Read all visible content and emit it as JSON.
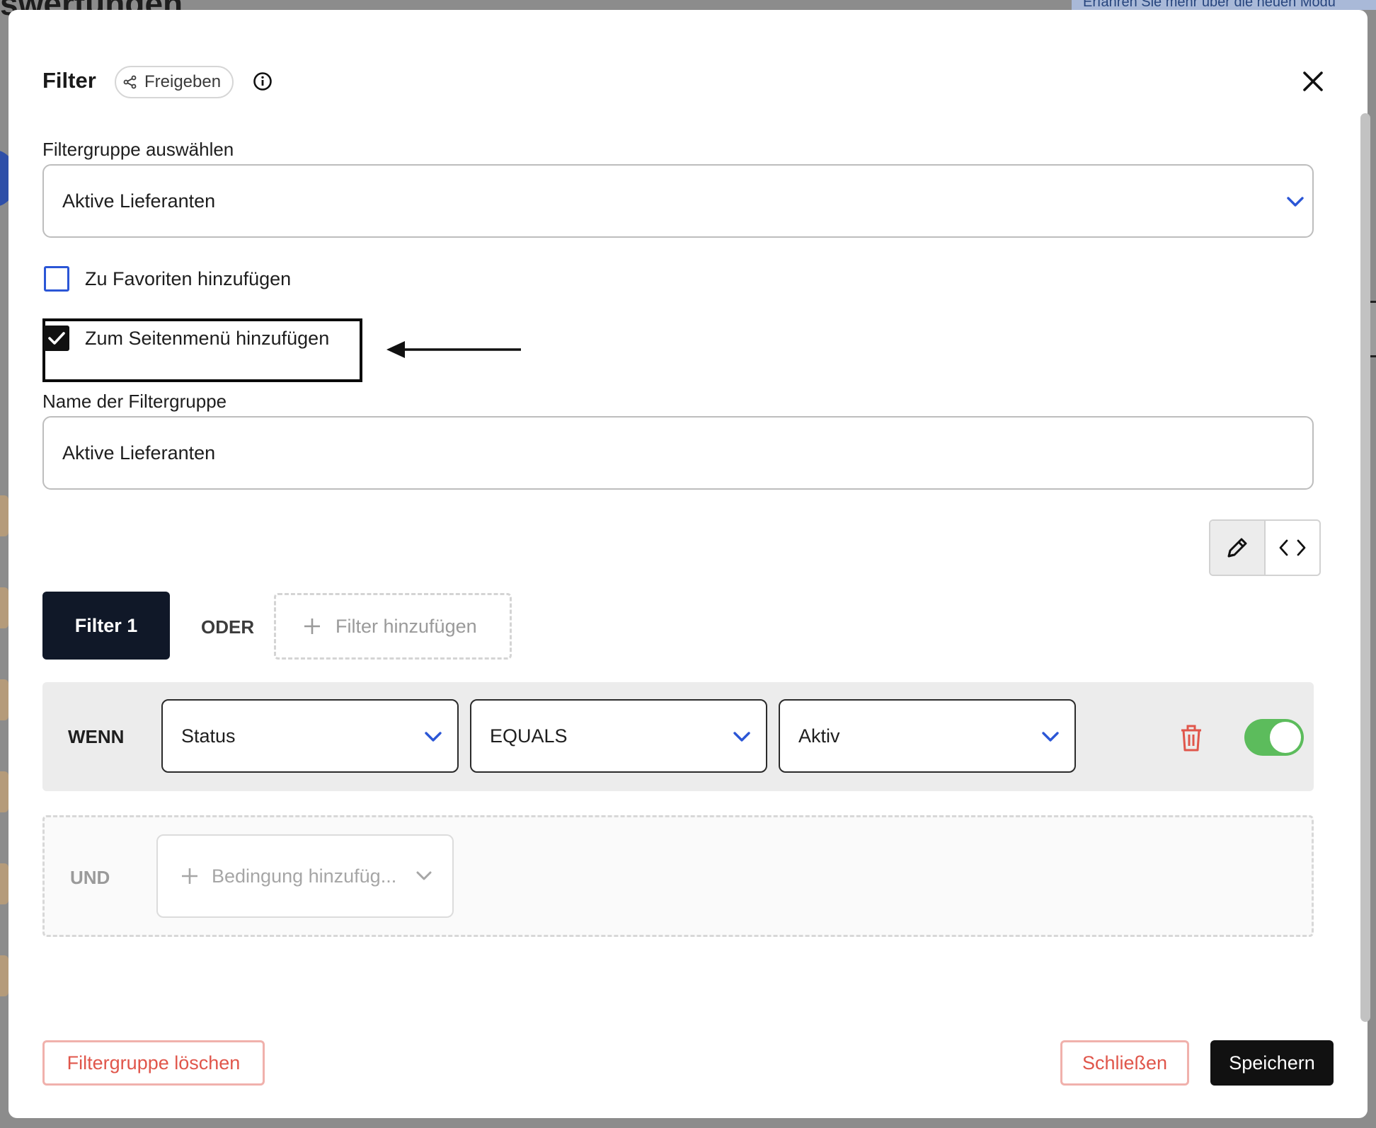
{
  "background": {
    "page_title_fragment": "swertungen",
    "banner_fragment": "Erfahren Sie mehr über die neuen Modu"
  },
  "modal": {
    "title": "Filter",
    "share_label": "Freigeben",
    "filtergroup_select": {
      "label": "Filtergruppe auswählen",
      "value": "Aktive Lieferanten"
    },
    "checkboxes": {
      "favorites": {
        "label": "Zu Favoriten hinzufügen",
        "checked": false
      },
      "sidemenu": {
        "label": "Zum Seitenmenü hinzufügen",
        "checked": true
      }
    },
    "name_field": {
      "label": "Name der Filtergruppe",
      "value": "Aktive Lieferanten"
    },
    "tabs": {
      "filter1": "Filter 1",
      "or_label": "ODER",
      "add_filter": "Filter hinzufügen"
    },
    "condition": {
      "when_label": "WENN",
      "field": "Status",
      "operator": "EQUALS",
      "value": "Aktiv",
      "enabled": true
    },
    "and_row": {
      "and_label": "UND",
      "add_condition_placeholder": "Bedingung hinzufüg..."
    },
    "footer": {
      "delete_label": "Filtergruppe löschen",
      "close_label": "Schließen",
      "save_label": "Speichern"
    }
  },
  "colors": {
    "accent_blue": "#2b56d6",
    "danger": "#e0564b",
    "toggle_on": "#5cbc5c",
    "dark": "#101828"
  }
}
